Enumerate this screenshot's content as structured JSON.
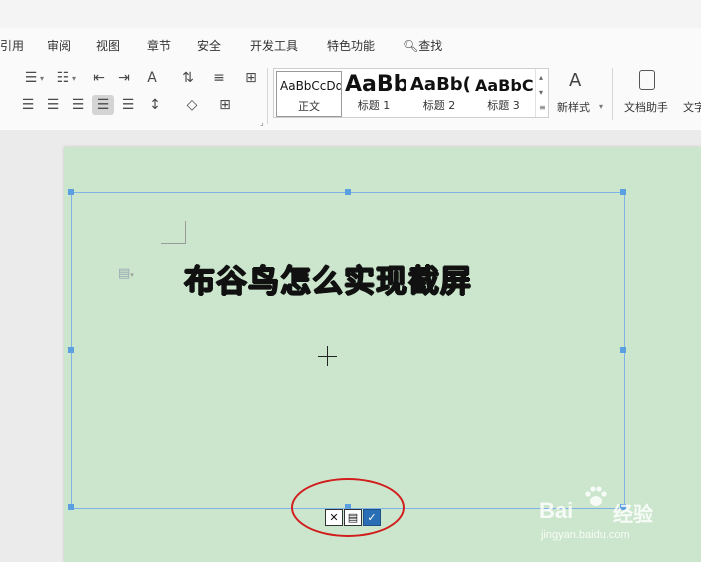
{
  "menu": {
    "items": [
      {
        "label": "引用"
      },
      {
        "label": "审阅"
      },
      {
        "label": "视图"
      },
      {
        "label": "章节"
      },
      {
        "label": "安全"
      },
      {
        "label": "开发工具"
      },
      {
        "label": "特色功能"
      },
      {
        "label": "查找"
      }
    ]
  },
  "ribbon": {
    "styles": [
      {
        "sample": "AaBbCcDd",
        "name": "正文"
      },
      {
        "sample": "AaBb",
        "name": "标题 1"
      },
      {
        "sample": "AaBb(",
        "name": "标题 2"
      },
      {
        "sample": "AaBbC",
        "name": "标题 3"
      }
    ],
    "new_style_label": "新样式",
    "doc_helper_label": "文档助手",
    "text_tool_label": "文字"
  },
  "document": {
    "headline": "布谷鸟怎么实现截屏"
  },
  "mini_toolbar": {
    "cancel": "✕",
    "save": "▤",
    "confirm": "✓"
  },
  "watermark": {
    "brand": "Bai",
    "brand2": "经验",
    "url": "jingyan.baidu.com"
  },
  "colors": {
    "page_bg": "#cbe6cc",
    "selection": "#5c9fe0",
    "annotation": "#d11d1d"
  }
}
